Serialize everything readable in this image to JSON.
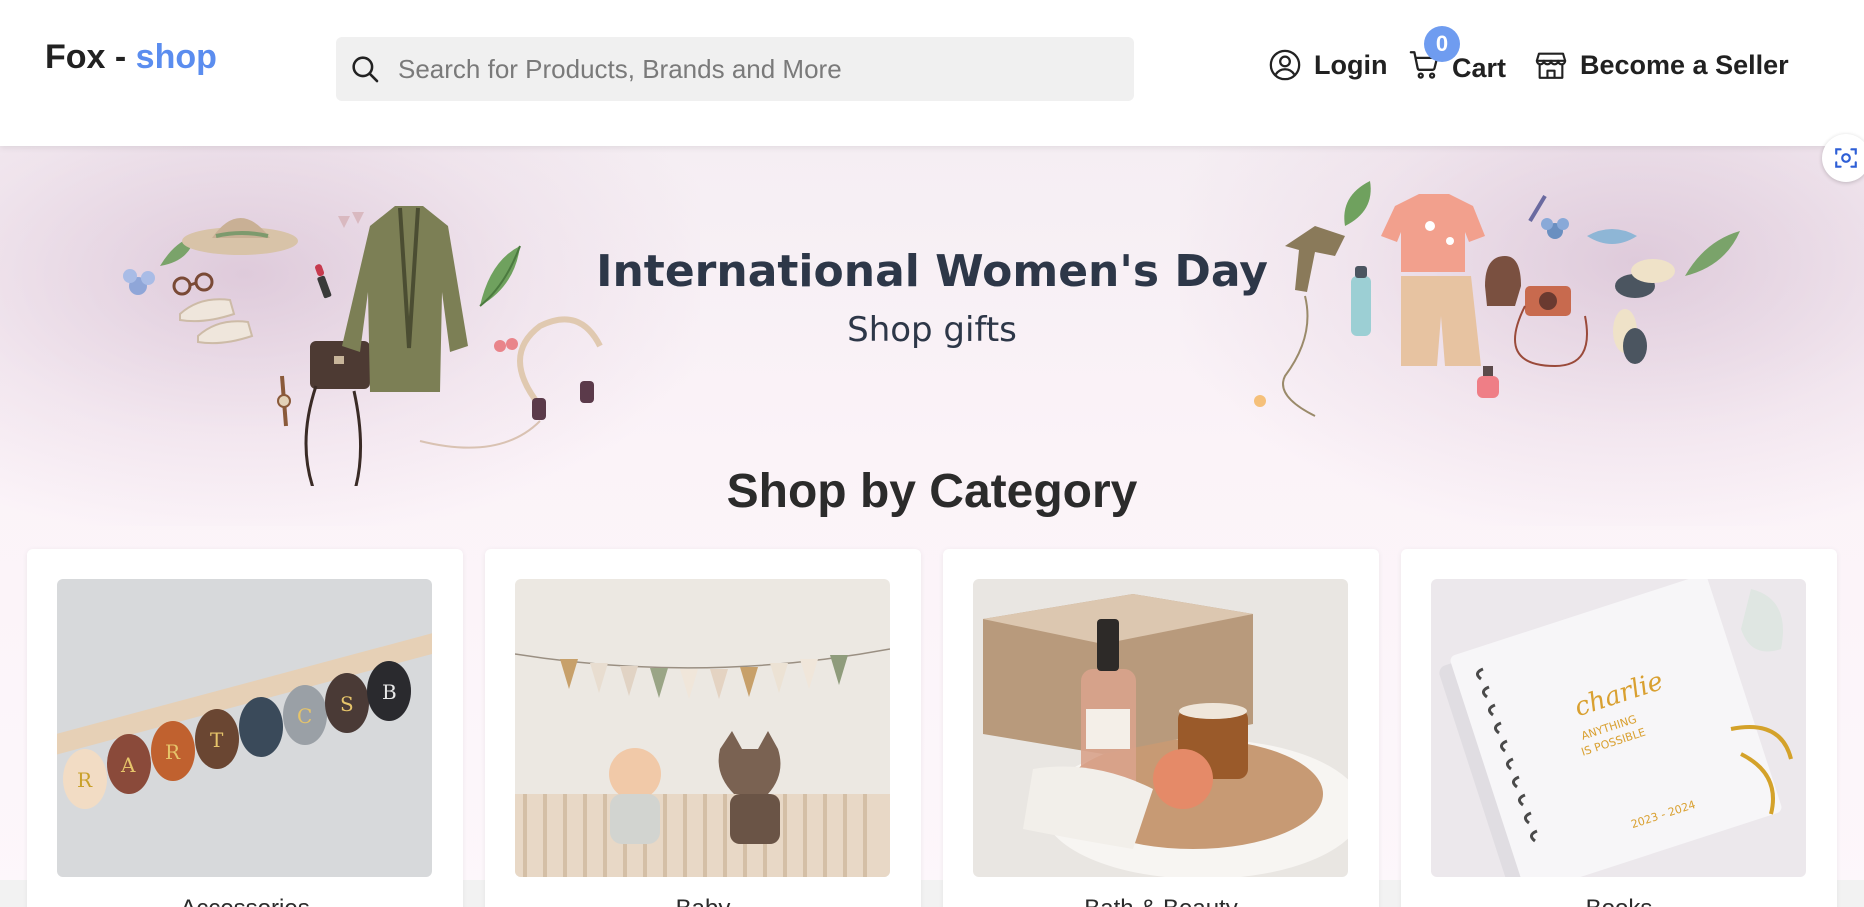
{
  "header": {
    "logo_main": "Fox - ",
    "logo_accent": "shop",
    "search_placeholder": "Search for Products, Brands and More",
    "login_label": "Login",
    "cart_label": "Cart",
    "cart_count": "0",
    "seller_label": "Become a Seller"
  },
  "banner": {
    "title": "International Women's Day",
    "subtitle": "Shop gifts"
  },
  "section": {
    "title": "Shop by Category"
  },
  "categories": [
    {
      "label": "Accessories"
    },
    {
      "label": "Baby"
    },
    {
      "label": "Bath & Beauty"
    },
    {
      "label": "Books"
    }
  ],
  "icons": {
    "search": "search-icon",
    "login": "user-circle-icon",
    "cart": "cart-icon",
    "seller": "store-icon",
    "scan": "scan-icon"
  },
  "colors": {
    "accent": "#5b8def",
    "badge": "#6f9cf0",
    "banner_bg": "#fbf3f8",
    "title_text": "#2d3748"
  }
}
